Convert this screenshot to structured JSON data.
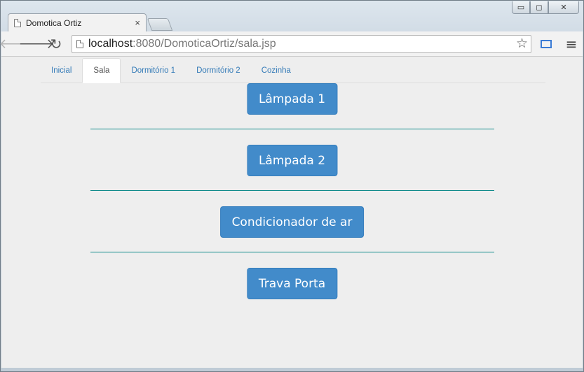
{
  "browser": {
    "tab_title": "Domotica Ortiz",
    "tab_close": "×",
    "url_host": "localhost",
    "url_path": ":8080/DomoticaOrtiz/sala.jsp",
    "icons": {
      "back": "back-arrow-icon",
      "forward": "forward-arrow-icon",
      "reload": "reload-icon",
      "star": "bookmark-star-icon",
      "menu": "hamburger-menu-icon"
    },
    "glyphs": {
      "back": "🡐",
      "forward": "🡒",
      "reload": "↻",
      "star": "☆",
      "menu": "≡",
      "minimize": "▭",
      "maximize": "◻",
      "close": "✕"
    }
  },
  "nav": {
    "tabs": [
      {
        "label": "Inicial",
        "active": false
      },
      {
        "label": "Sala",
        "active": true
      },
      {
        "label": "Dormitório 1",
        "active": false
      },
      {
        "label": "Dormitório 2",
        "active": false
      },
      {
        "label": "Cozinha",
        "active": false
      }
    ]
  },
  "devices": [
    {
      "label": "Lâmpada 1"
    },
    {
      "label": "Lâmpada 2"
    },
    {
      "label": "Condicionador de ar"
    },
    {
      "label": "Trava Porta"
    }
  ],
  "colors": {
    "button_bg": "#428bca",
    "separator": "#0e8a8a",
    "link": "#337ab7"
  }
}
